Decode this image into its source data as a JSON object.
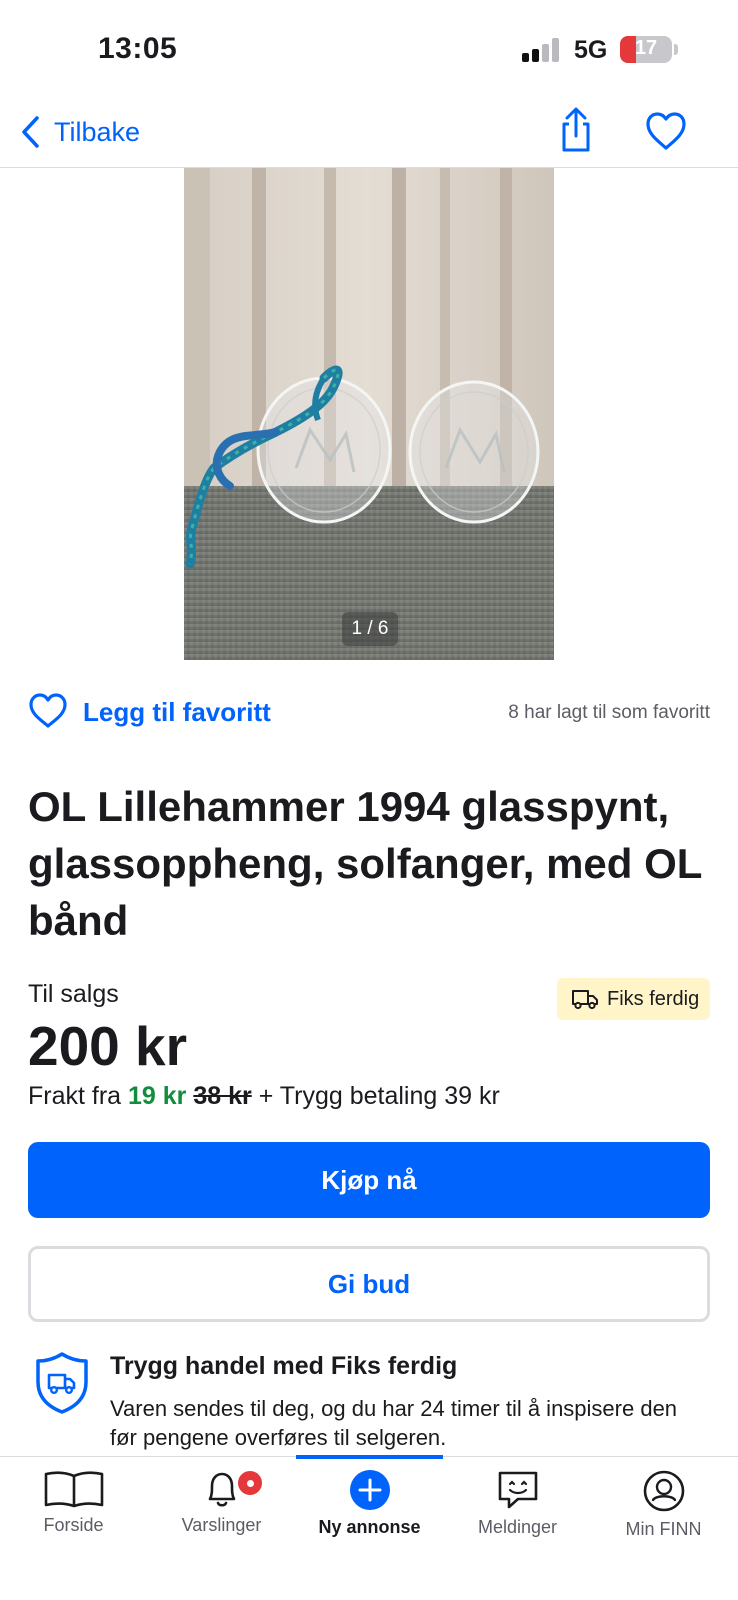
{
  "status_bar": {
    "time": "13:05",
    "network": "5G",
    "battery": "17"
  },
  "nav": {
    "back_label": "Tilbake"
  },
  "gallery": {
    "counter": "1 / 6"
  },
  "favorite": {
    "label": "Legg til favoritt",
    "count_text": "8 har lagt til som favoritt"
  },
  "listing": {
    "title": "OL Lillehammer 1994 glasspynt, glassoppheng, solfanger, med OL bånd",
    "sale_label": "Til salgs",
    "badge_label": "Fiks ferdig",
    "price": "200 kr",
    "shipping": {
      "prefix": "Frakt fra ",
      "price": "19 kr",
      "old_price": "38 kr",
      "suffix": " + Trygg betaling 39 kr"
    }
  },
  "actions": {
    "buy_label": "Kjøp nå",
    "bid_label": "Gi bud"
  },
  "safe_trade": {
    "title": "Trygg handel med Fiks ferdig",
    "description": "Varen sendes til deg, og du har 24 timer til å inspisere den før pengene overføres til selgeren."
  },
  "tab_bar": {
    "items": [
      {
        "label": "Forside",
        "icon": "book-icon"
      },
      {
        "label": "Varslinger",
        "icon": "bell-icon"
      },
      {
        "label": "Ny annonse",
        "icon": "plus-circle-icon"
      },
      {
        "label": "Meldinger",
        "icon": "chat-icon"
      },
      {
        "label": "Min FINN",
        "icon": "profile-icon"
      }
    ],
    "active_index": 2
  },
  "colors": {
    "accent": "#0063fb",
    "price_green": "#118d3d",
    "badge_bg": "#fff5c8",
    "notification": "#e5383b"
  }
}
